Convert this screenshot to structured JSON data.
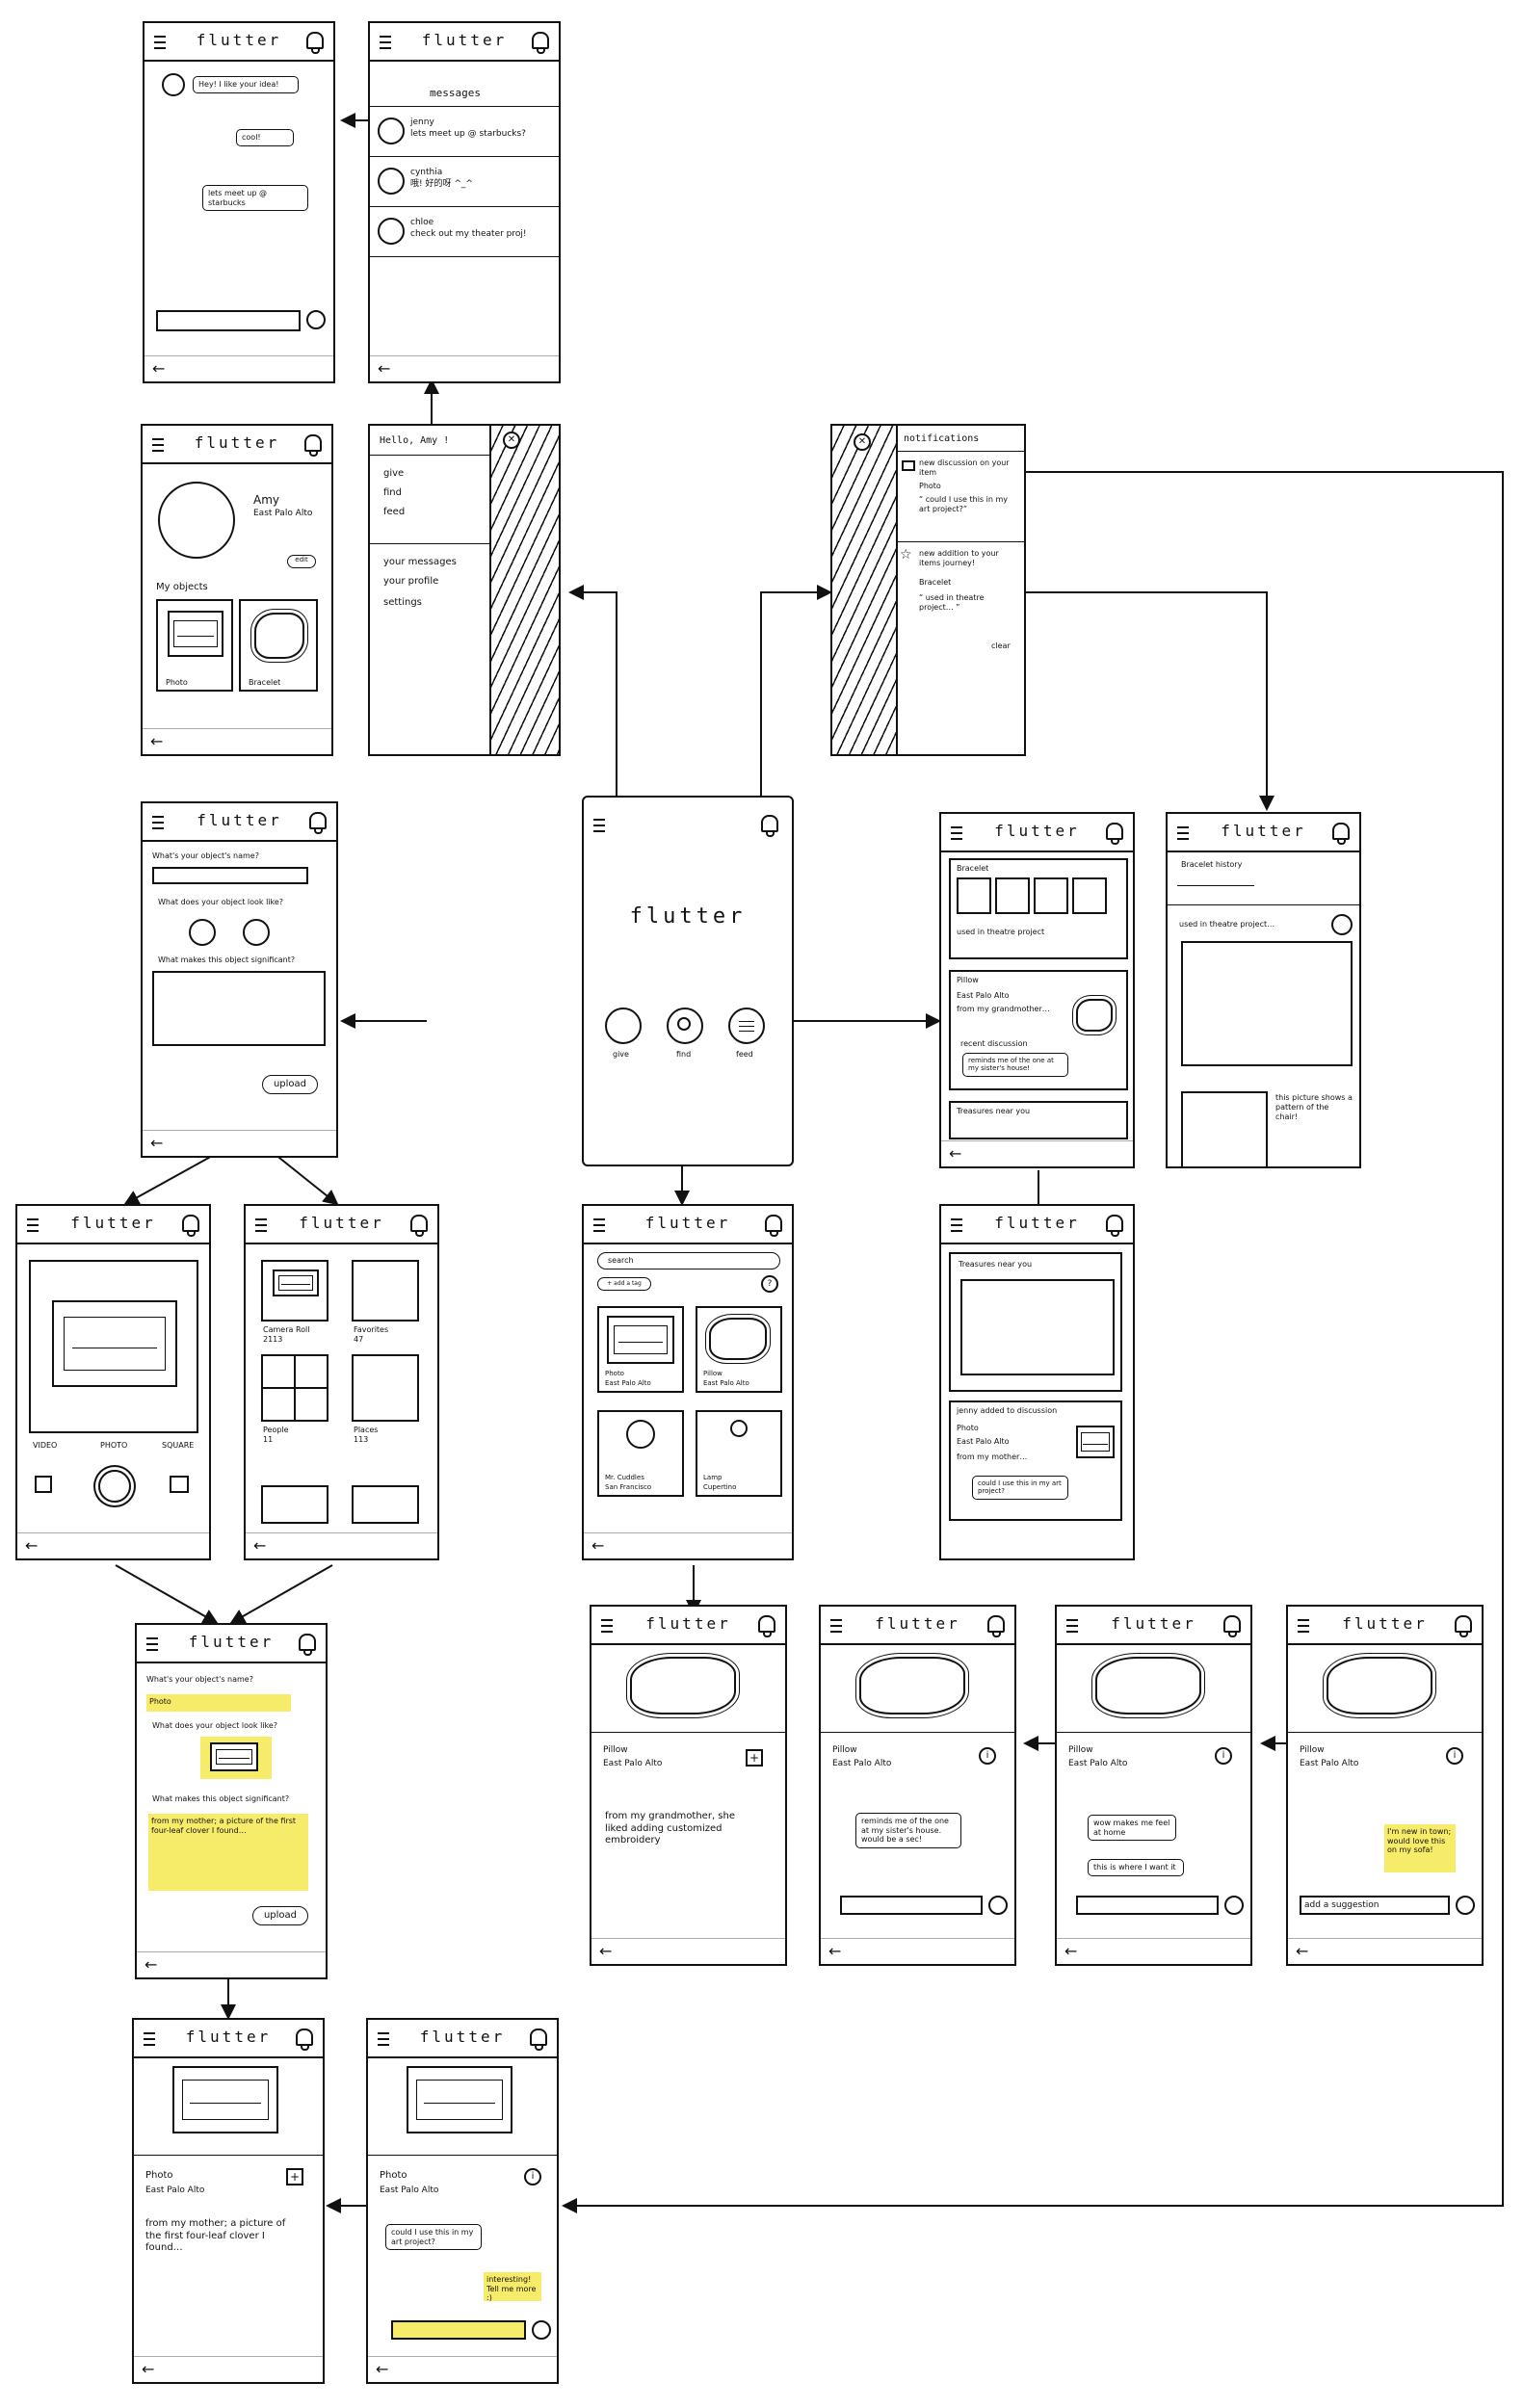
{
  "brand": "flutter",
  "back": "←",
  "home": {
    "title": "flutter",
    "give": "give",
    "find": "find",
    "feed": "feed"
  },
  "menu": {
    "greeting": "Hello, Amy !",
    "items": [
      "give",
      "find",
      "feed",
      "your messages",
      "your profile",
      "settings"
    ]
  },
  "messages": {
    "title": "messages",
    "items": [
      {
        "name": "jenny",
        "text": "lets meet up @ starbucks?"
      },
      {
        "name": "cynthia",
        "text": "哦! 好的呀 ^_^"
      },
      {
        "name": "chloe",
        "text": "check out my theater proj!"
      }
    ]
  },
  "chat": {
    "bubbles": [
      "Hey! I like your idea!",
      "cool!",
      "lets meet up @ starbucks"
    ]
  },
  "profile": {
    "name": "Amy",
    "location": "East Palo Alto",
    "edit": "edit",
    "my_objects": "My objects",
    "objects": [
      "Photo",
      "Bracelet"
    ]
  },
  "notifications": {
    "title": "notifications",
    "items": [
      {
        "head": "new discussion on your item",
        "item": "Photo",
        "quote": "“ could I use this in my art project?”"
      },
      {
        "head": "new addition to your items journey!",
        "item": "Bracelet",
        "quote": "“ used in theatre project… ”"
      }
    ],
    "clear": "clear"
  },
  "give_form": {
    "q1": "What's your object's name?",
    "q2": "What does your object look like?",
    "q3": "What makes this object significant?",
    "upload": "upload"
  },
  "camera": {
    "modes": [
      "VIDEO",
      "PHOTO",
      "SQUARE"
    ]
  },
  "gallery": {
    "albums": [
      {
        "name": "Camera Roll",
        "count": "2113"
      },
      {
        "name": "Favorites",
        "count": "47"
      },
      {
        "name": "People",
        "count": "11"
      },
      {
        "name": "Places",
        "count": "113"
      }
    ]
  },
  "filled_form": {
    "q1": "What's your object's name?",
    "name_value": "Photo",
    "q2": "What does your object look like?",
    "q3": "What makes this object significant?",
    "desc_value": "from my mother; a picture of the first four-leaf clover I found…",
    "upload": "upload"
  },
  "search": {
    "placeholder": "search",
    "add_tag": "+ add a tag",
    "results": [
      {
        "name": "Photo",
        "loc": "East Palo Alto"
      },
      {
        "name": "Pillow",
        "loc": "East Palo Alto"
      },
      {
        "name": "Mr. Cuddles",
        "loc": "San Francisco"
      },
      {
        "name": "Lamp",
        "loc": "Cupertino"
      }
    ]
  },
  "feed": {
    "bracelet": "Bracelet",
    "bracelet_note": "used in theatre project",
    "pillow": "Pillow",
    "pillow_loc": "East Palo Alto",
    "pillow_from": "from my grandmother…",
    "recent": "recent discussion",
    "recent_quote": "reminds me of the one at my sister's house!",
    "treasures": "Treasures near you"
  },
  "history": {
    "title": "Bracelet history",
    "used": "used in theatre project…",
    "caption": "this picture shows a pattern of the chair!"
  },
  "map_feed": {
    "treasures": "Treasures near you",
    "added": "jenny added to discussion",
    "item": "Photo",
    "loc": "East Palo Alto",
    "from": "from my mother…",
    "quote": "could I use this in my art project?"
  },
  "pillow": {
    "name": "Pillow",
    "loc": "East Palo Alto",
    "desc": "from my grandmother, she liked adding customized embroidery",
    "c1": "reminds me of the one at my sister's house. would be a sec!",
    "c2a": "wow makes me feel at home",
    "c2b": "this is where I want it",
    "sticky": "I'm new in town; would love this on my sofa!",
    "suggest": "add a suggestion"
  },
  "photo_item": {
    "name": "Photo",
    "loc": "East Palo Alto",
    "desc": "from my mother; a picture of the first four-leaf clover I found…",
    "comment": "could I use this in my art project?",
    "sticky": "interesting! Tell me more :)"
  }
}
